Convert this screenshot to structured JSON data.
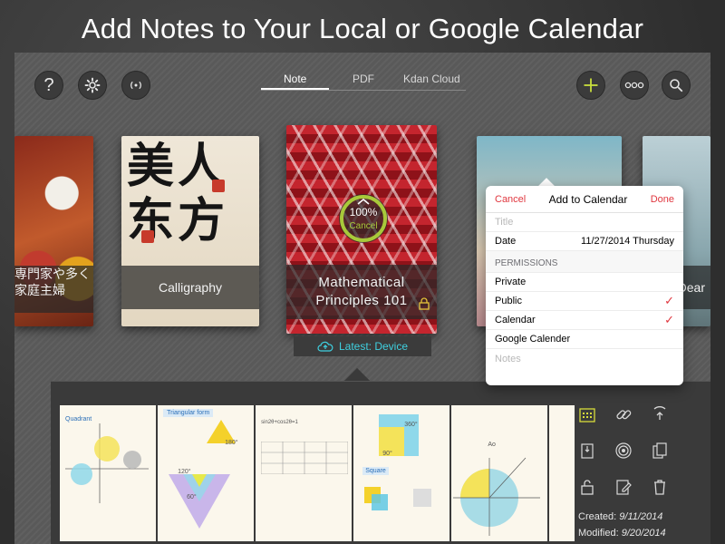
{
  "headline": "Add Notes to Your Local or Google Calendar",
  "toolbar": {
    "left_icons": [
      "help-icon",
      "gear-icon",
      "wireless-icon"
    ],
    "right_icons": [
      "add-icon",
      "more-icon",
      "search-icon"
    ],
    "tabs": [
      {
        "label": "Note",
        "active": true
      },
      {
        "label": "PDF",
        "active": false
      },
      {
        "label": "Kdan Cloud",
        "active": false
      }
    ]
  },
  "books": {
    "left": {
      "title_line1": "専門家や多く",
      "title_line2": "家庭主婦"
    },
    "calligraphy": {
      "title": "Calligraphy",
      "glyphs": "美人东方"
    },
    "math": {
      "title_line1": "Mathematical",
      "title_line2": "Principles 101",
      "progress_text": "100%",
      "progress_cancel": "Cancel",
      "progress_value": 1.0,
      "latest": "Latest: Device"
    },
    "dear": {
      "title": "Dear"
    }
  },
  "popover": {
    "cancel": "Cancel",
    "title": "Add to Calendar",
    "done": "Done",
    "title_placeholder": "Title",
    "date_label": "Date",
    "date_value": "11/27/2014 Thursday",
    "permissions_header": "PERMISSIONS",
    "options": [
      {
        "label": "Private",
        "checked": false
      },
      {
        "label": "Public",
        "checked": true
      },
      {
        "label": "Calendar",
        "checked": true
      },
      {
        "label": "Google Calender",
        "checked": false
      }
    ],
    "notes_placeholder": "Notes",
    "check_glyph": "✓"
  },
  "pages": {
    "p1_label": "Quadrant",
    "p2_label": "Triangular form",
    "p2_value": "180°",
    "p2_angle1": "120°",
    "p2_angle2": "60°",
    "p3_formula": "sin2θ+cos2θ=1",
    "p4_label": "Square",
    "p4_value1": "360°",
    "p4_value2": "90°",
    "p5_label": "Ao"
  },
  "meta": {
    "created_label": "Created:",
    "created_value": "9/11/2014",
    "modified_label": "Modified:",
    "modified_value": "9/20/2014"
  },
  "colors": {
    "accent_green": "#a8c93a",
    "accent_red": "#e0373f",
    "cloud_cyan": "#3fd0e0"
  }
}
